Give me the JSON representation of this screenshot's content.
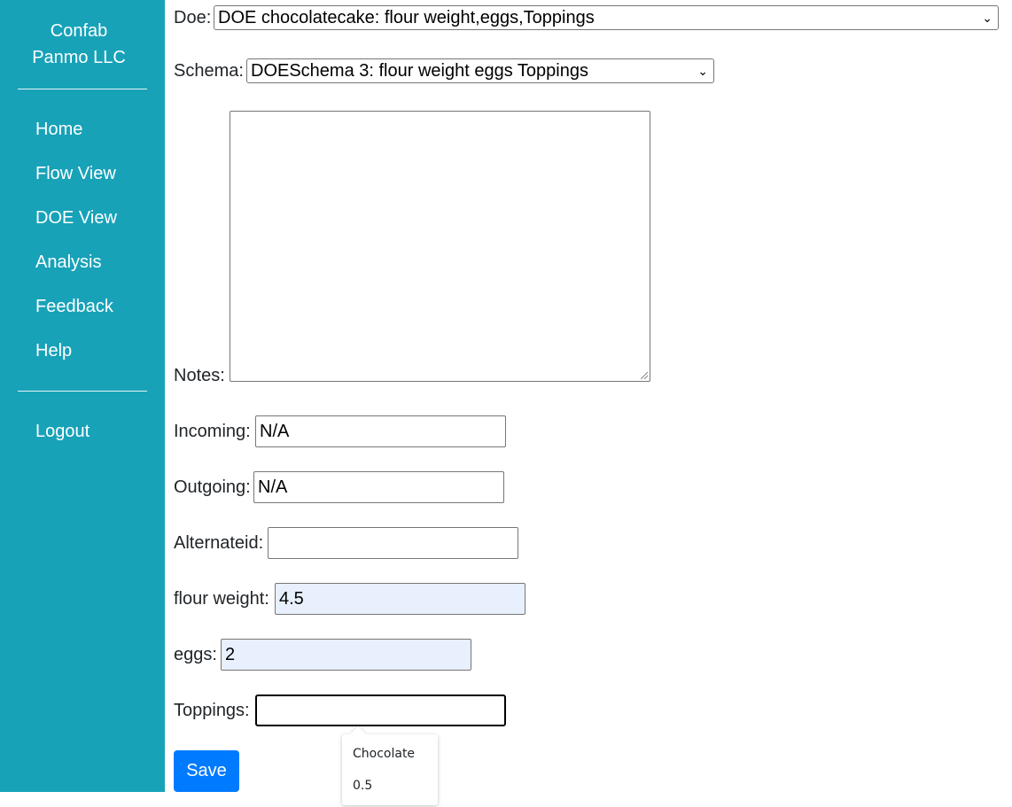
{
  "sidebar": {
    "brand": "Confab\nPanmo LLC",
    "brand_line1": "Confab",
    "brand_line2": "Panmo LLC",
    "nav": [
      "Home",
      "Flow View",
      "DOE View",
      "Analysis",
      "Feedback",
      "Help"
    ],
    "logout": "Logout"
  },
  "form": {
    "doe": {
      "label": "Doe:",
      "value": "DOE chocolatecake: flour weight,eggs,Toppings"
    },
    "schema": {
      "label": "Schema:",
      "value": "DOESchema 3: flour weight eggs Toppings"
    },
    "notes": {
      "label": "Notes:",
      "value": ""
    },
    "incoming": {
      "label": "Incoming:",
      "value": "N/A"
    },
    "outgoing": {
      "label": "Outgoing:",
      "value": "N/A"
    },
    "alternateid": {
      "label": "Alternateid:",
      "value": ""
    },
    "flour_weight": {
      "label": "flour weight:",
      "value": "4.5"
    },
    "eggs": {
      "label": "eggs:",
      "value": "2"
    },
    "toppings": {
      "label": "Toppings:",
      "value": ""
    },
    "save_label": "Save"
  },
  "autocomplete": {
    "options": [
      "Chocolate",
      "0.5"
    ]
  },
  "colors": {
    "sidebar_bg": "#17a2b8",
    "save_button": "#007bff",
    "autofill_bg": "#e8f0fe"
  }
}
